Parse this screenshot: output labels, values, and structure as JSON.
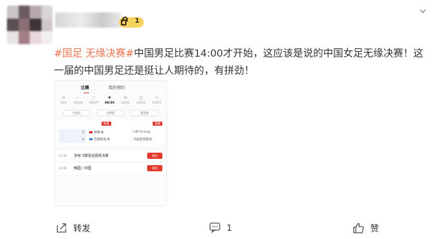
{
  "post": {
    "author_badge_level": "1",
    "tags": [
      "#国足",
      "无缘决赛#"
    ],
    "text": "中国男足比赛14:00才开始，这应该是说的中国女足无缘决赛！这一届的中国男足还是挺让人期待的，有拼劲！"
  },
  "shot": {
    "tab_active": "比赛",
    "tab_other": "我的预约",
    "days": [
      {
        "wk": "日",
        "d": "9/27"
      },
      {
        "wk": "一",
        "d": "09/28"
      },
      {
        "wk": "二",
        "d": "09/29"
      },
      {
        "wk": "今",
        "d": "09/30"
      },
      {
        "wk": "四",
        "d": "10/01"
      },
      {
        "wk": "五",
        "d": "10/02"
      },
      {
        "wk": "六",
        "d": "10/03"
      }
    ],
    "pills": [
      "中国队",
      "金牌赛",
      "看直播"
    ],
    "live_label": "直播",
    "match": {
      "score_a": "5",
      "score_b": "0",
      "team_a": "伊朗",
      "team_b": "巴基斯坦",
      "pts_a": "8",
      "pts_b": "0",
      "right_a": "LIN Yu-ting",
      "right_b": "乌兹别克斯坦"
    },
    "events": [
      {
        "time": "15:30",
        "title": "多哈飞碟混合团体决赛",
        "btn": "预约"
      },
      {
        "time": "14:00",
        "title": "韩国 / 中国",
        "btn": "预约"
      }
    ]
  },
  "footer": {
    "share_label": "转发",
    "comment_count": "1",
    "like_label": "赞"
  },
  "colors": {
    "tag": "#eb7350",
    "accent_red": "#e23a2e",
    "badge_yellow": "#f6d35e"
  }
}
